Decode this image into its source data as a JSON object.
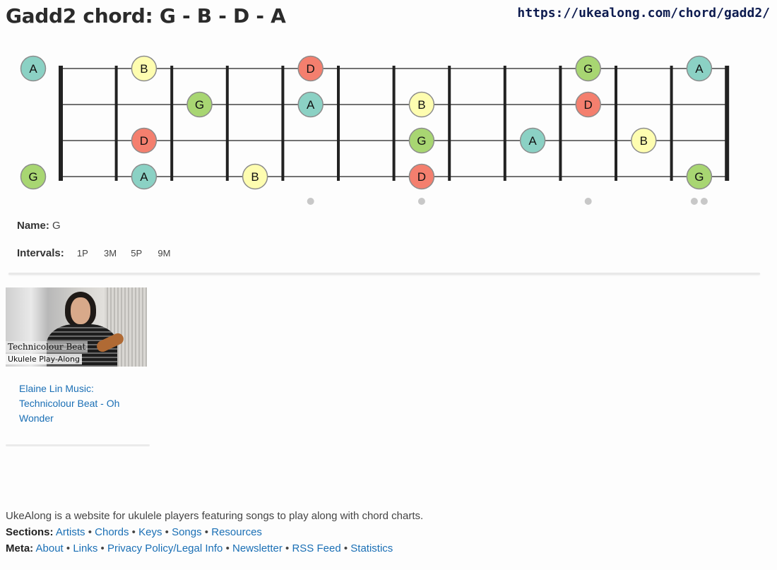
{
  "page": {
    "title": "Gadd2 chord: G - B - D - A",
    "url": "https://ukealong.com/chord/gadd2/"
  },
  "colors": {
    "G": "#a8d672",
    "B": "#fefdb0",
    "D": "#f47f6e",
    "A": "#8bd1c4",
    "fret": "#222222",
    "string": "#444444",
    "marker": "#c8c8c8"
  },
  "fretboard": {
    "strings": [
      {
        "open": "A",
        "notes": [
          {
            "fret": 2,
            "label": "B"
          },
          {
            "fret": 5,
            "label": "D"
          },
          {
            "fret": 10,
            "label": "G"
          },
          {
            "fret": 12,
            "label": "A"
          }
        ]
      },
      {
        "open": "",
        "notes": [
          {
            "fret": 3,
            "label": "G"
          },
          {
            "fret": 5,
            "label": "A"
          },
          {
            "fret": 7,
            "label": "B"
          },
          {
            "fret": 10,
            "label": "D"
          }
        ]
      },
      {
        "open": "",
        "notes": [
          {
            "fret": 2,
            "label": "D"
          },
          {
            "fret": 7,
            "label": "G"
          },
          {
            "fret": 9,
            "label": "A"
          },
          {
            "fret": 11,
            "label": "B"
          }
        ]
      },
      {
        "open": "G",
        "notes": [
          {
            "fret": 2,
            "label": "A"
          },
          {
            "fret": 4,
            "label": "B"
          },
          {
            "fret": 7,
            "label": "D"
          },
          {
            "fret": 12,
            "label": "G"
          }
        ]
      }
    ],
    "markers": [
      5,
      7,
      10,
      12
    ]
  },
  "info": {
    "name_label": "Name:",
    "name_value": "G",
    "intervals_label": "Intervals:",
    "intervals": [
      "1P",
      "3M",
      "5P",
      "9M"
    ]
  },
  "video": {
    "thumb_title": "Technicolour Beat",
    "thumb_subtitle": "Ukulele Play-Along",
    "link_text": "Elaine Lin Music: Technicolour Beat - Oh Wonder"
  },
  "footer": {
    "about": "UkeAlong is a website for ukulele players featuring songs to play along with chord charts.",
    "sections_label": "Sections:",
    "sections": [
      "Artists",
      "Chords",
      "Keys",
      "Songs",
      "Resources"
    ],
    "meta_label": "Meta:",
    "meta": [
      "About",
      "Links",
      "Privacy Policy/Legal Info",
      "Newsletter",
      "RSS Feed",
      "Statistics"
    ]
  }
}
